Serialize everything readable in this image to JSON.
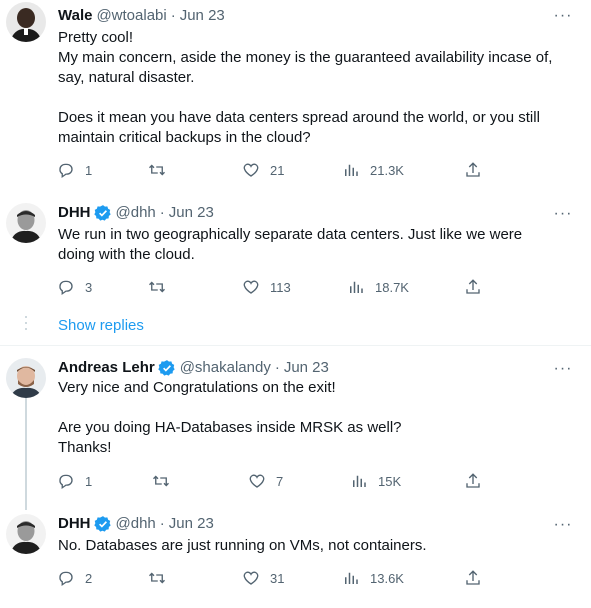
{
  "tweets": [
    {
      "name": "Wale",
      "handle": "@wtoalabi",
      "time": "Jun 23",
      "verified": false,
      "lines": [
        "Pretty cool!",
        "My main concern, aside the money is the guaranteed availability incase of,",
        "say, natural disaster.",
        "",
        "Does it mean you have data centers spread around the world, or you still",
        "maintain critical backups in the cloud?"
      ],
      "replies": "1",
      "retweets": "",
      "likes": "21",
      "views": "21.3K"
    },
    {
      "name": "DHH",
      "handle": "@dhh",
      "time": "Jun 23",
      "verified": true,
      "lines": [
        "We run in two geographically separate data centers. Just like we were",
        "doing with the cloud."
      ],
      "replies": "3",
      "retweets": "",
      "likes": "113",
      "views": "18.7K"
    },
    {
      "name": "Andreas Lehr",
      "handle": "@shakalandy",
      "time": "Jun 23",
      "verified": true,
      "lines": [
        "Very nice and Congratulations on the exit!",
        "",
        "Are you doing HA-Databases inside MRSK as well?",
        "Thanks!"
      ],
      "replies": "1",
      "retweets": "",
      "likes": "7",
      "views": "15K"
    },
    {
      "name": "DHH",
      "handle": "@dhh",
      "time": "Jun 23",
      "verified": true,
      "lines": [
        "No. Databases are just running on VMs, not containers."
      ],
      "replies": "2",
      "retweets": "",
      "likes": "31",
      "views": "13.6K"
    }
  ],
  "show_replies_label": "Show replies",
  "separator": "·",
  "colors": {
    "text": "#0f1419",
    "secondary": "#536471",
    "accent": "#1d9bf0",
    "divider": "#eff3f4"
  },
  "icons": [
    "reply-icon",
    "retweet-icon",
    "like-icon",
    "views-icon",
    "share-icon",
    "more-icon",
    "verified-badge-icon"
  ]
}
